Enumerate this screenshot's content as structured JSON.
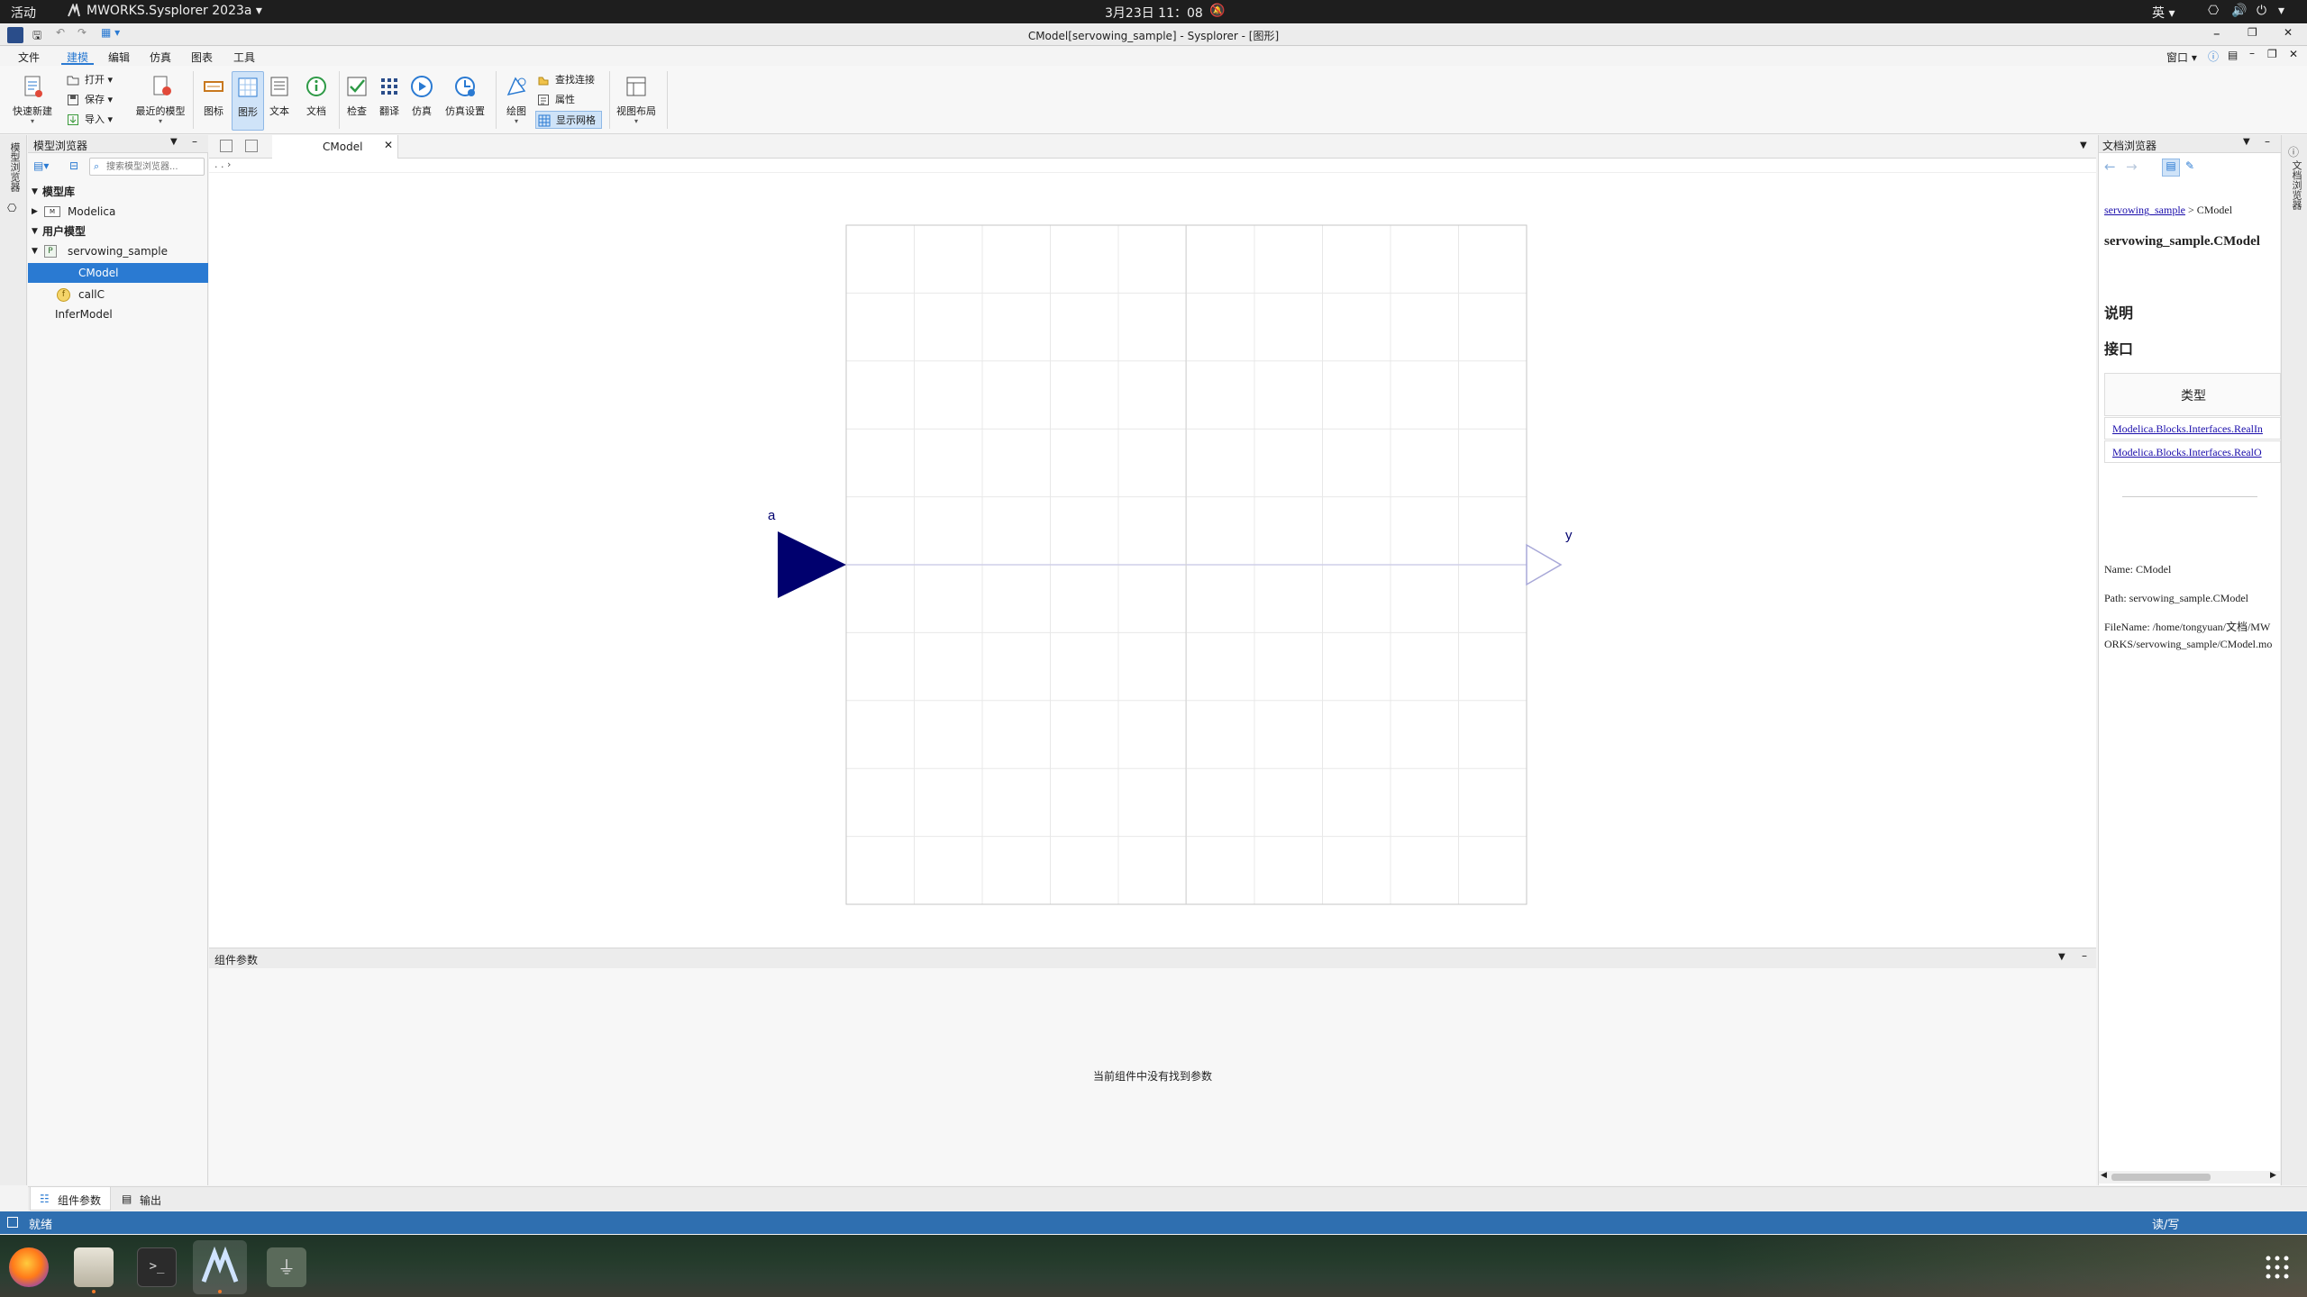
{
  "topbar": {
    "activities": "活动",
    "app_name": "MWORKS.Sysplorer 2023a",
    "datetime": "3月23日 11：08",
    "ime": "英"
  },
  "window": {
    "title": "CModel[servowing_sample] - Sysplorer - [图形]",
    "window_menu": "窗口"
  },
  "menu": {
    "items": [
      "文件",
      "建模",
      "编辑",
      "仿真",
      "图表",
      "工具"
    ],
    "active": "建模"
  },
  "ribbon": {
    "quick_new": "快速新建",
    "open": "打开",
    "save": "保存",
    "import": "导入",
    "recent": "最近的模型",
    "icon_view": "图标",
    "diagram_view": "图形",
    "text_view": "文本",
    "doc_view": "文档",
    "check": "检查",
    "translate": "翻译",
    "simulate": "仿真",
    "sim_settings": "仿真设置",
    "draw": "绘图",
    "find_connection": "查找连接",
    "properties": "属性",
    "show_grid": "显示网格",
    "view_layout": "视图布局"
  },
  "model_browser": {
    "title": "模型浏览器",
    "search_placeholder": "搜索模型浏览器...",
    "library_header": "模型库",
    "library_items": [
      "Modelica"
    ],
    "user_header": "用户模型",
    "package": "servowing_sample",
    "children": [
      "CModel",
      "callC"
    ],
    "selected": "CModel",
    "other": "InferModel",
    "side_tab": "模型浏览器"
  },
  "editor": {
    "tab_label": "CModel",
    "breadcrumb": ". . ›",
    "input_label": "a",
    "output_label": "y",
    "input_color": "#00006e",
    "output_color": "#a8a8d8"
  },
  "params": {
    "title": "组件参数",
    "empty_message": "当前组件中没有找到参数"
  },
  "doc_browser": {
    "title": "文档浏览器",
    "breadcrumb_link": "servowing_sample",
    "breadcrumb_rest": " > CModel",
    "heading": "servowing_sample.CModel",
    "section_description": "说明",
    "section_interface": "接口",
    "table_header": "类型",
    "table_rows": [
      "Modelica.Blocks.Interfaces.RealIn",
      "Modelica.Blocks.Interfaces.RealO"
    ],
    "name_line": "Name: CModel",
    "path_line": "Path: servowing_sample.CModel",
    "filename_line": "FileName: /home/tongyuan/文档/MWORKS/servowing_sample/CModel.mo",
    "side_tab": "文档浏览器"
  },
  "bottom_tabs": [
    "组件参数",
    "输出"
  ],
  "status": {
    "ready": "就绪",
    "mode": "读/写"
  },
  "colors": {
    "accent": "#2a7ad2",
    "status_bar": "#2f6fb0"
  }
}
